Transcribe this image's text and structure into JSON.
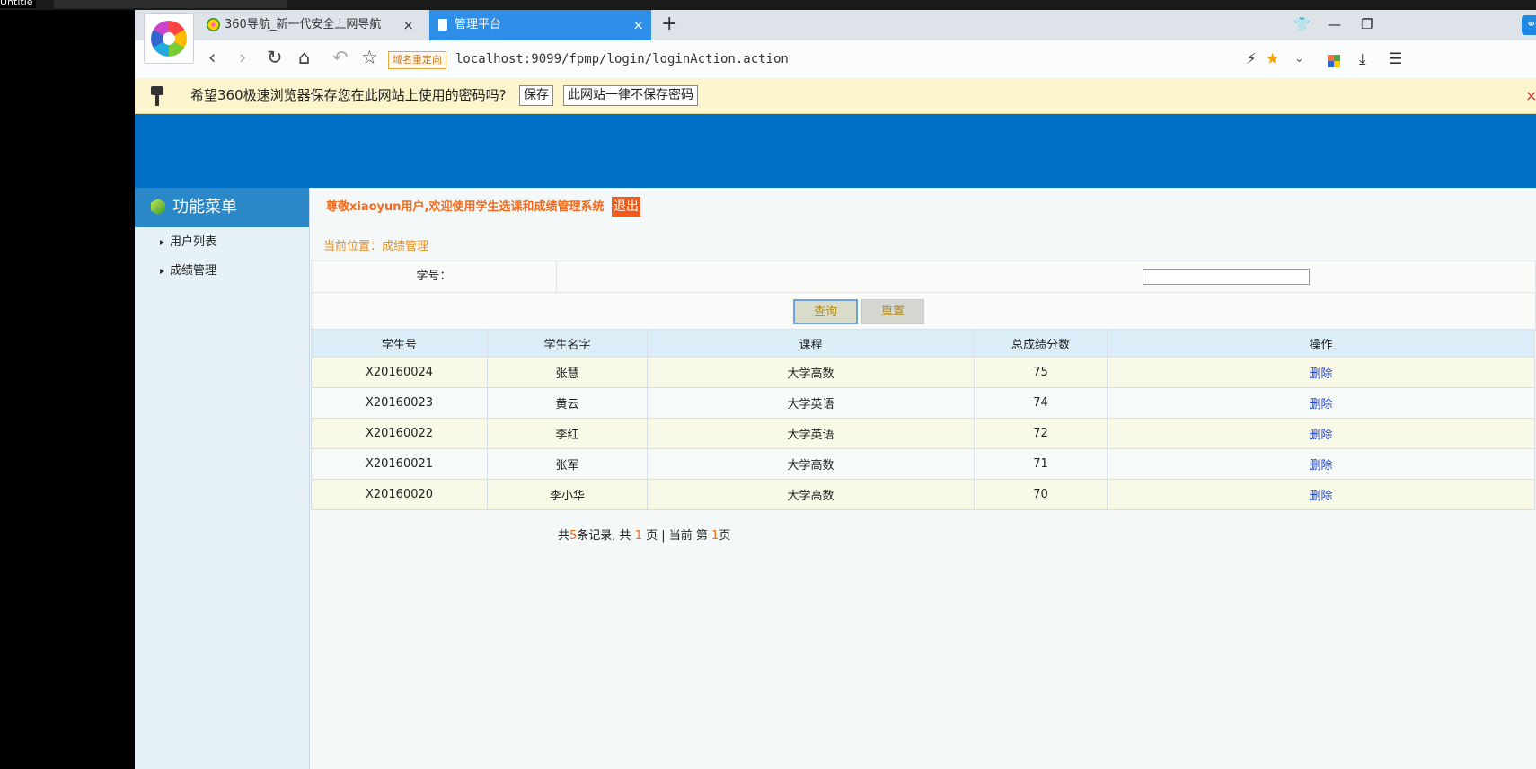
{
  "desktop": {
    "title": "Untitle"
  },
  "browser": {
    "tabs": [
      {
        "label": "360导航_新一代安全上网导航",
        "close": "×"
      },
      {
        "label": "管理平台",
        "close": "×"
      }
    ],
    "new_tab": "+",
    "window_controls": {
      "skin": "👕",
      "minimize": "—",
      "restore": "❐"
    },
    "nav": {
      "back": "‹",
      "forward": "›",
      "reload": "↻",
      "home": "⌂",
      "undo": "↶",
      "star": "☆"
    },
    "domain_tag": "域名重定向",
    "url": "localhost:9099/fpmp/login/loginAction.action",
    "right_icons": {
      "flash": "⚡",
      "favorite": "★",
      "dropdown": "⌄",
      "download": "⤓",
      "menu": "☰"
    },
    "password_bar": {
      "message": "希望360极速浏览器保存您在此网站上使用的密码吗?",
      "save": "保存",
      "never": "此网站一律不保存密码",
      "close": "×"
    }
  },
  "sidebar": {
    "title": "功能菜单",
    "items": [
      {
        "label": "用户列表"
      },
      {
        "label": "成绩管理"
      }
    ]
  },
  "header": {
    "welcome": "尊敬xiaoyun用户,欢迎使用学生选课和成绩管理系统",
    "logout": "退出"
  },
  "breadcrumb": "当前位置：成绩管理",
  "search": {
    "label": "学号：",
    "value": "",
    "query_button": "查询",
    "reset_button": "重置"
  },
  "table": {
    "columns": [
      "学生号",
      "学生名字",
      "课程",
      "总成绩分数",
      "操作"
    ],
    "rows": [
      [
        "X20160024",
        "张慧",
        "大学高数",
        "75",
        "删除"
      ],
      [
        "X20160023",
        "黄云",
        "大学英语",
        "74",
        "删除"
      ],
      [
        "X20160022",
        "李红",
        "大学英语",
        "72",
        "删除"
      ],
      [
        "X20160021",
        "张军",
        "大学高数",
        "71",
        "删除"
      ],
      [
        "X20160020",
        "李小华",
        "大学高数",
        "70",
        "删除"
      ]
    ]
  },
  "pager": {
    "prefix": "共",
    "records": "5",
    "records_suffix": "条记录, 共 ",
    "pages": "1",
    "pages_suffix": " 页 | 当前 第 ",
    "current": "1",
    "current_suffix": "页"
  },
  "colors": {
    "banner": "#0070c4",
    "accent_orange": "#f26b1d",
    "active_tab": "#2f8ee8",
    "link_blue": "#1a3fd8"
  }
}
